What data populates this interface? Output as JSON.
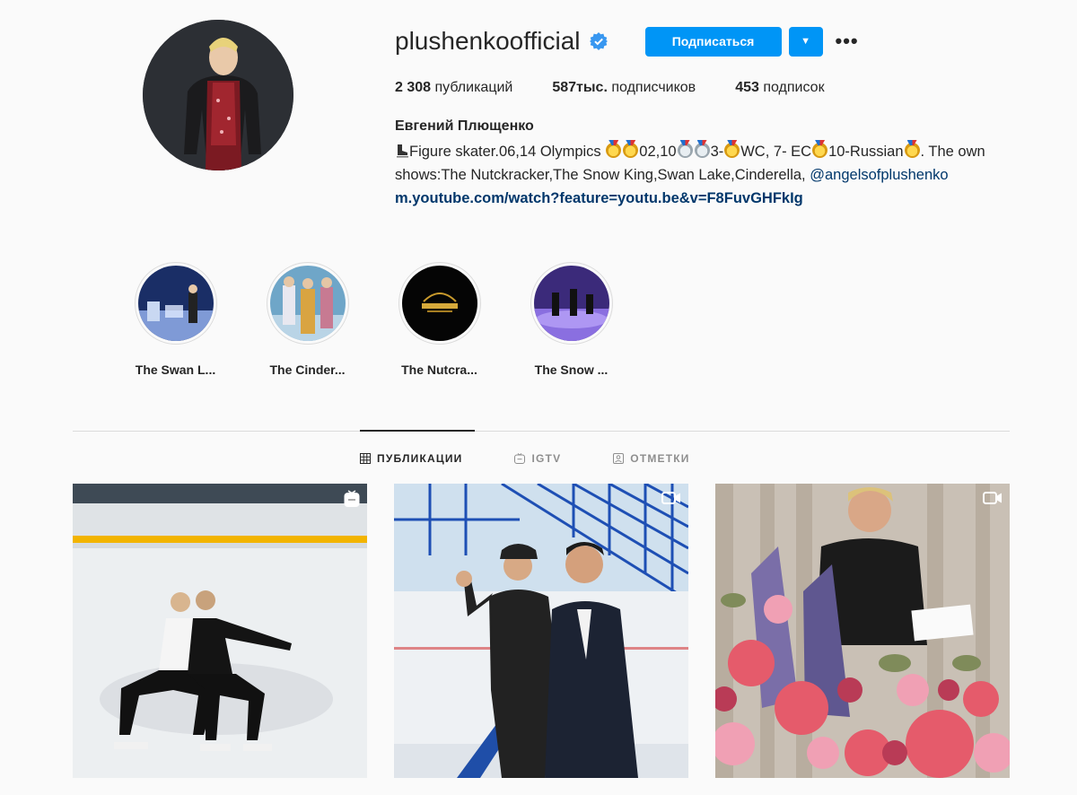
{
  "profile": {
    "username": "plushenkoofficial",
    "follow_label": "Подписаться",
    "stats": {
      "posts_count": "2 308",
      "posts_label": "публикаций",
      "followers_count": "587тыс.",
      "followers_label": "подписчиков",
      "following_count": "453",
      "following_label": "подписок"
    },
    "full_name": "Евгений Плющенко",
    "bio": {
      "part1": "Figure skater.06,14 Olympics ",
      "part2": "02,10",
      "part3": "3-",
      "part4": "WC, 7- EC",
      "part5": "10-Russian",
      "part6": ". The own shows:The Nutckracker,The Snow King,Swan Lake,Cinderella, ",
      "mention": "@angelsofplushenko",
      "link": "m.youtube.com/watch?feature=youtu.be&v=F8FuvGHFkIg"
    }
  },
  "highlights": [
    {
      "label": "The Swan L..."
    },
    {
      "label": "The Cinder..."
    },
    {
      "label": "The Nutcra..."
    },
    {
      "label": "The Snow ..."
    }
  ],
  "tabs": [
    {
      "label": "ПУБЛИКАЦИИ",
      "icon": "grid-icon"
    },
    {
      "label": "IGTV",
      "icon": "igtv-icon"
    },
    {
      "label": "ОТМЕТКИ",
      "icon": "tagged-icon"
    }
  ],
  "colors": {
    "accent": "#0095f6",
    "link": "#00376b",
    "background": "#fafafa"
  }
}
